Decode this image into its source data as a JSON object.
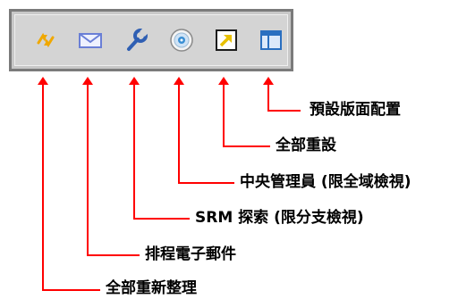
{
  "toolbar": {
    "buttons": [
      {
        "icon": "refresh-all-icon",
        "label": "全部重新整理"
      },
      {
        "icon": "email-icon",
        "label": "排程電子郵件"
      },
      {
        "icon": "wrench-icon",
        "label": "SRM 探索 (限分支檢視)"
      },
      {
        "icon": "disc-icon",
        "label": "中央管理員 (限全域檢視)"
      },
      {
        "icon": "reset-arrow-icon",
        "label": "全部重設"
      },
      {
        "icon": "layout-icon",
        "label": "預設版面配置"
      }
    ]
  },
  "colors": {
    "arrow": "#ff0000",
    "toolbar_bg": "#d4d4d4",
    "refresh": "#f0a800",
    "email": "#6a7fd6",
    "wrench": "#2f5fb3",
    "disc": "#3a8fd4",
    "reset_arrow": "#e8c000",
    "layout": "#2a6fc0"
  }
}
